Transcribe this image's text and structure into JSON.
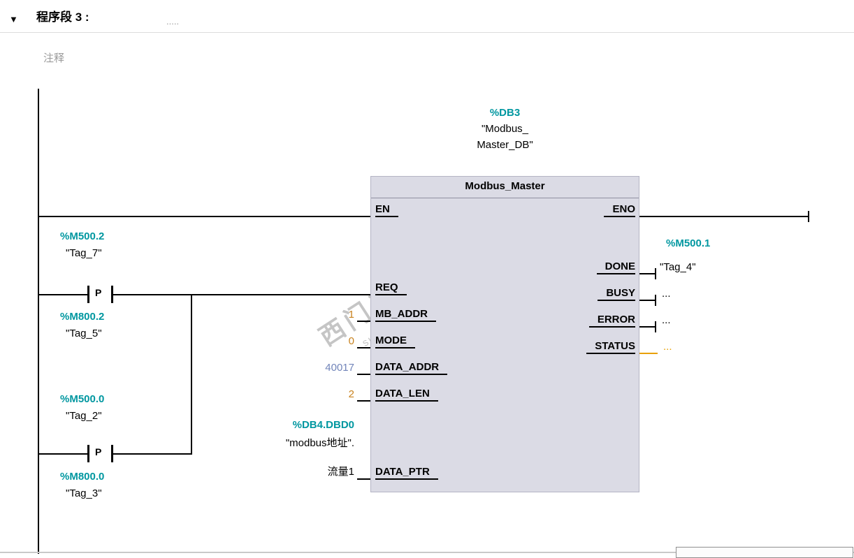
{
  "colors": {
    "address_teal": "#0097A0",
    "constant_orange": "#C8821E",
    "pointer_blue": "#7285BA",
    "status_orange": "#E8A000",
    "block_fill": "#DBDBE5",
    "wire_black": "#000000"
  },
  "header": {
    "collapse_icon": "▼",
    "title": "程序段 3 :",
    "dots": "....."
  },
  "comment": {
    "placeholder": "注释"
  },
  "instance_db": {
    "address": "%DB3",
    "name_line1": "\"Modbus_",
    "name_line2": "Master_DB\""
  },
  "block": {
    "title": "Modbus_Master",
    "pins": {
      "en": "EN",
      "eno": "ENO",
      "req": "REQ",
      "mb_addr": "MB_ADDR",
      "mode": "MODE",
      "data_addr": "DATA_ADDR",
      "data_len": "DATA_LEN",
      "data_ptr": "DATA_PTR",
      "done": "DONE",
      "busy": "BUSY",
      "error": "ERROR",
      "status": "STATUS"
    }
  },
  "operands": {
    "mb_addr": "1",
    "mode": "0",
    "data_addr": "40017",
    "data_len": "2",
    "data_ptr_address": "%DB4.DBD0",
    "data_ptr_name": "\"modbus地址\".",
    "data_ptr_member": "流量1",
    "done_address": "%M500.1",
    "done_name": "\"Tag_4\"",
    "busy": "...",
    "error": "...",
    "status": "..."
  },
  "contacts": [
    {
      "type": "P",
      "address": "%M500.2",
      "name": "\"Tag_7\"",
      "edge_address": "%M800.2",
      "edge_name": "\"Tag_5\""
    },
    {
      "type": "P",
      "address": "%M500.0",
      "name": "\"Tag_2\"",
      "edge_address": "%M800.0",
      "edge_name": "\"Tag_3\""
    }
  ],
  "watermark": {
    "line1": "西门子工业 找答案",
    "line2": "support.industry.siemens.com/cs"
  }
}
